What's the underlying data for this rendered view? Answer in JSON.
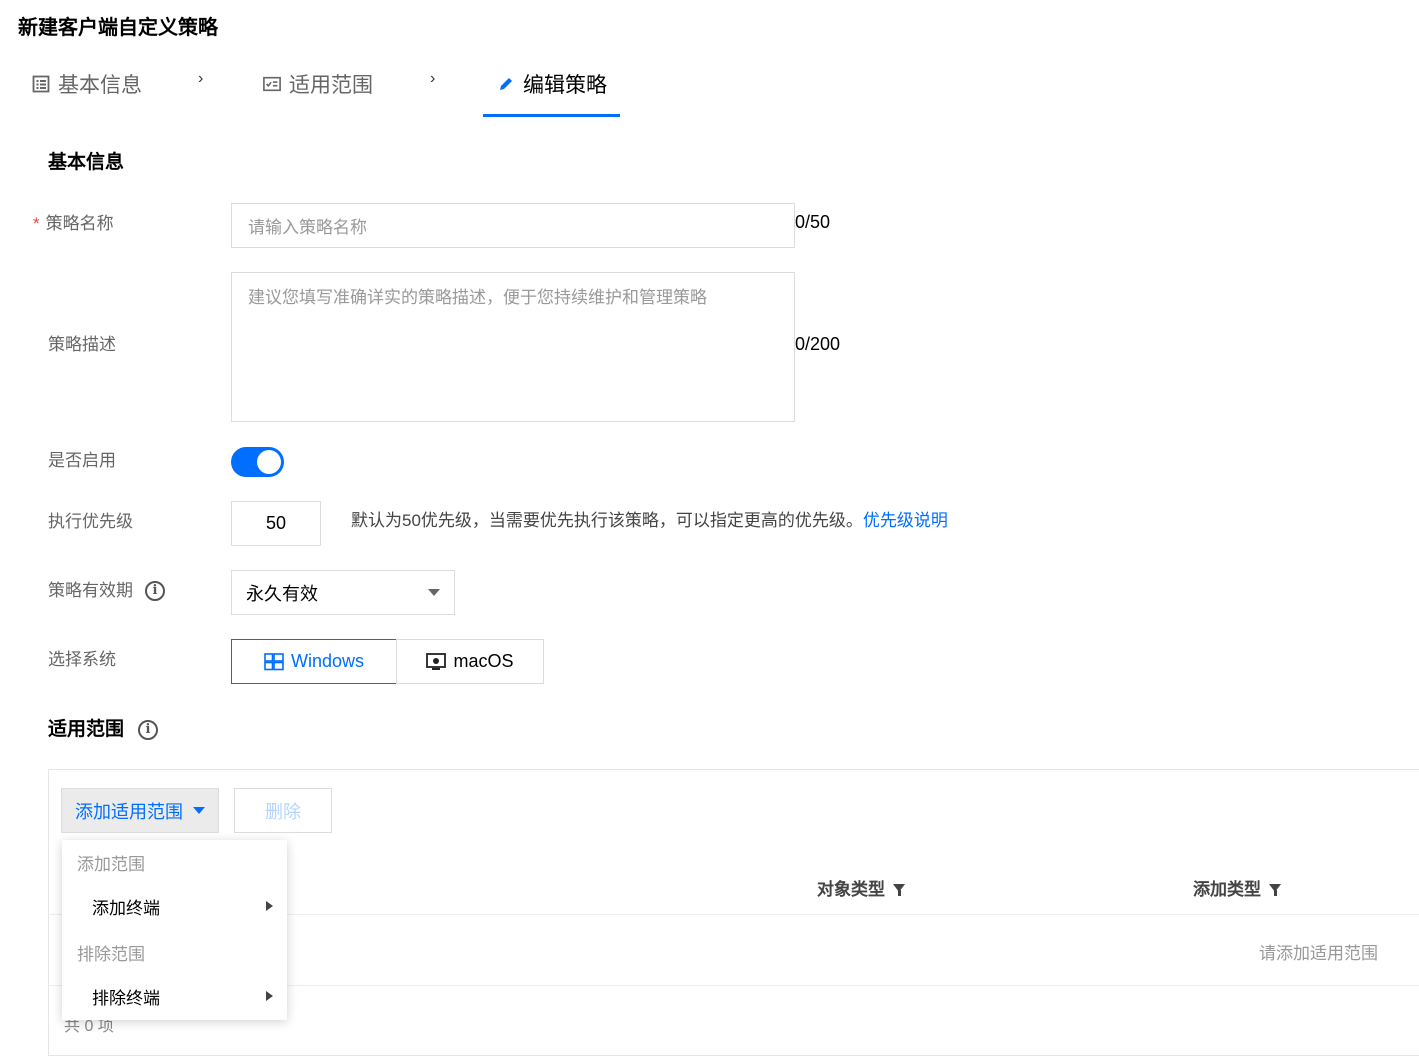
{
  "page_title": "新建客户端自定义策略",
  "steps": [
    {
      "label": "基本信息",
      "icon": "list-icon"
    },
    {
      "label": "适用范围",
      "icon": "checklist-icon"
    },
    {
      "label": "编辑策略",
      "icon": "pencil-icon"
    }
  ],
  "step_separator": "›",
  "basic": {
    "section_title": "基本信息",
    "name_label": "策略名称",
    "name_placeholder": "请输入策略名称",
    "name_counter": "0/50",
    "desc_label": "策略描述",
    "desc_placeholder": "建议您填写准确详实的策略描述，便于您持续维护和管理策略",
    "desc_counter": "0/200",
    "enable_label": "是否启用",
    "enabled": true,
    "priority_label": "执行优先级",
    "priority_value": "50",
    "priority_hint": "默认为50优先级，当需要优先执行该策略，可以指定更高的优先级。",
    "priority_link": "优先级说明",
    "validity_label": "策略有效期",
    "validity_value": "永久有效",
    "system_label": "选择系统",
    "system_options": [
      "Windows",
      "macOS"
    ],
    "system_selected": "Windows"
  },
  "scope": {
    "section_title": "适用范围",
    "add_button": "添加适用范围",
    "delete_button": "删除",
    "columns": [
      "对象类型",
      "添加类型"
    ],
    "empty_text": "请添加适用范围",
    "total_text": "共 0 项",
    "dropdown": {
      "groups": [
        {
          "title": "添加范围",
          "items": [
            "添加终端"
          ]
        },
        {
          "title": "排除范围",
          "items": [
            "排除终端"
          ]
        }
      ]
    }
  },
  "colors": {
    "accent": "#006eff",
    "required": "#e54545"
  }
}
